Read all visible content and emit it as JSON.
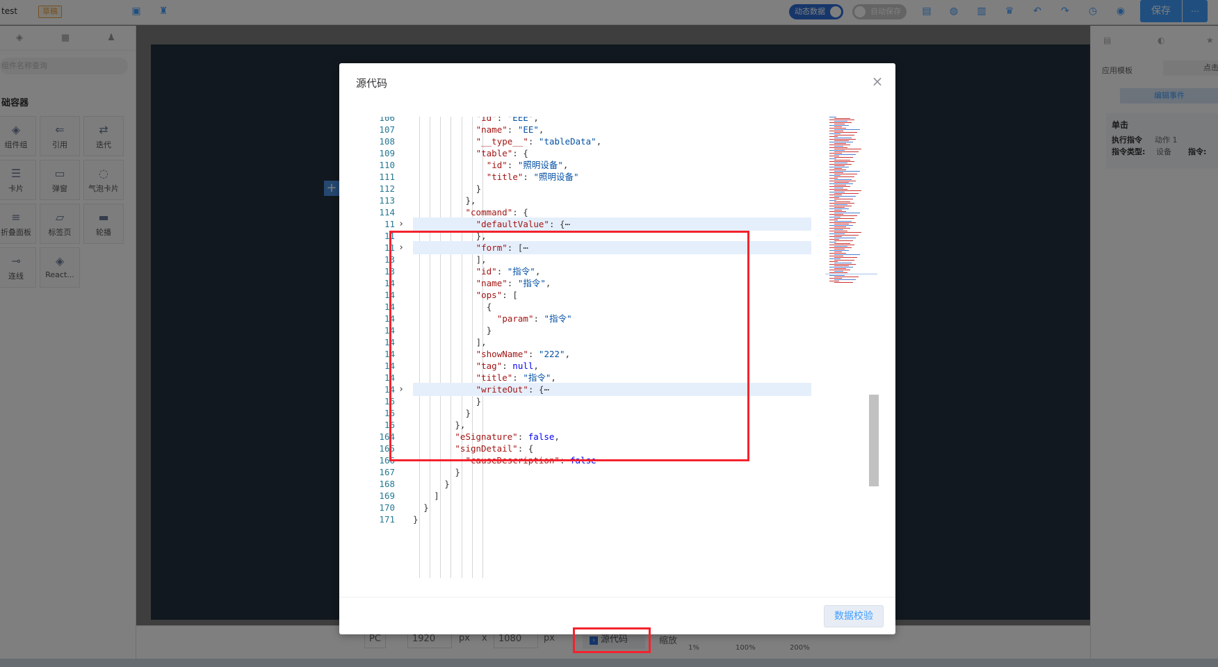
{
  "app": {
    "title": "test",
    "draft_badge": "草稿",
    "dynamic_data_label": "动态数据",
    "autosave_label": "自动保存",
    "save_label": "保存",
    "more_label": "⋯"
  },
  "sidebar": {
    "search_placeholder": "组件名称查询",
    "section_title": "础容器",
    "items": [
      {
        "label": "组件组",
        "icon": "layers-icon"
      },
      {
        "label": "引用",
        "icon": "reference-icon"
      },
      {
        "label": "迭代",
        "icon": "loop-icon"
      },
      {
        "label": "卡片",
        "icon": "card-icon"
      },
      {
        "label": "弹窗",
        "icon": "popup-icon"
      },
      {
        "label": "气泡卡片",
        "icon": "bubble-card-icon"
      },
      {
        "label": "折叠面板",
        "icon": "collapse-icon"
      },
      {
        "label": "标签页",
        "icon": "tabs-icon"
      },
      {
        "label": "轮播",
        "icon": "carousel-icon"
      },
      {
        "label": "连线",
        "icon": "connector-icon"
      },
      {
        "label": "React...",
        "icon": "react-icon"
      }
    ]
  },
  "rightbar": {
    "app_template_label": "应用模板",
    "click_label": "点击",
    "edit_event_label": "编辑事件",
    "event_title": "单击",
    "exec_cmd_label": "执行指令",
    "exec_cmd_value": "动作 1",
    "cmd_type_label": "指令类型:",
    "cmd_type_value": "设备",
    "cmd_label": "指令:"
  },
  "bottombar": {
    "device": "PC",
    "width": "1920",
    "width_unit": "px",
    "times": "x",
    "height": "1080",
    "height_unit": "px",
    "source_label": "源代码",
    "zoom_label": "缩放",
    "zoom_min": "1%",
    "zoom_mid": "100%",
    "zoom_max": "200%"
  },
  "modal": {
    "title": "源代码",
    "close": "×",
    "validate_label": "数据校验",
    "lines": [
      {
        "n": "106",
        "indent": 12,
        "code": "\"id\": \"EEE\","
      },
      {
        "n": "107",
        "indent": 12,
        "code": "\"name\": \"EE\","
      },
      {
        "n": "108",
        "indent": 12,
        "code": "\"__type__\": \"tableData\","
      },
      {
        "n": "109",
        "indent": 12,
        "code": "\"table\": {"
      },
      {
        "n": "110",
        "indent": 14,
        "code": "\"id\": \"照明设备\","
      },
      {
        "n": "111",
        "indent": 14,
        "code": "\"title\": \"照明设备\""
      },
      {
        "n": "112",
        "indent": 12,
        "code": "}"
      },
      {
        "n": "113",
        "indent": 10,
        "code": "},"
      },
      {
        "n": "114",
        "indent": 10,
        "code": "\"command\": {"
      },
      {
        "n": "11",
        "indent": 12,
        "code": "\"defaultValue\": {⋯",
        "fold": true
      },
      {
        "n": "11",
        "indent": 12,
        "code": "},"
      },
      {
        "n": "11",
        "indent": 12,
        "code": "\"form\": [⋯",
        "fold": true
      },
      {
        "n": "13",
        "indent": 12,
        "code": "],"
      },
      {
        "n": "13",
        "indent": 12,
        "code": "\"id\": \"指令\","
      },
      {
        "n": "14",
        "indent": 12,
        "code": "\"name\": \"指令\","
      },
      {
        "n": "14",
        "indent": 12,
        "code": "\"ops\": ["
      },
      {
        "n": "14",
        "indent": 14,
        "code": "{"
      },
      {
        "n": "14",
        "indent": 16,
        "code": "\"param\": \"指令\""
      },
      {
        "n": "14",
        "indent": 14,
        "code": "}"
      },
      {
        "n": "14",
        "indent": 12,
        "code": "],"
      },
      {
        "n": "14",
        "indent": 12,
        "code": "\"showName\": \"222\","
      },
      {
        "n": "14",
        "indent": 12,
        "code": "\"tag\": null,"
      },
      {
        "n": "14",
        "indent": 12,
        "code": "\"title\": \"指令\","
      },
      {
        "n": "14",
        "indent": 12,
        "code": "\"writeOut\": {⋯",
        "fold": true
      },
      {
        "n": "16",
        "indent": 12,
        "code": "}"
      },
      {
        "n": "16",
        "indent": 10,
        "code": "}"
      },
      {
        "n": "16",
        "indent": 8,
        "code": "},"
      },
      {
        "n": "164",
        "indent": 8,
        "code": "\"eSignature\": false,"
      },
      {
        "n": "165",
        "indent": 8,
        "code": "\"signDetail\": {"
      },
      {
        "n": "166",
        "indent": 10,
        "code": "\"causeDescription\": false"
      },
      {
        "n": "167",
        "indent": 8,
        "code": "}"
      },
      {
        "n": "168",
        "indent": 6,
        "code": "}"
      },
      {
        "n": "169",
        "indent": 4,
        "code": "]"
      },
      {
        "n": "170",
        "indent": 2,
        "code": "}"
      },
      {
        "n": "171",
        "indent": 0,
        "code": "}"
      }
    ]
  },
  "colors": {
    "accent": "#409eff",
    "highlight_box": "#f5222d",
    "json_key": "#a31515",
    "json_string": "#0451a5",
    "json_keyword": "#0000ff",
    "line_number": "#237893"
  }
}
